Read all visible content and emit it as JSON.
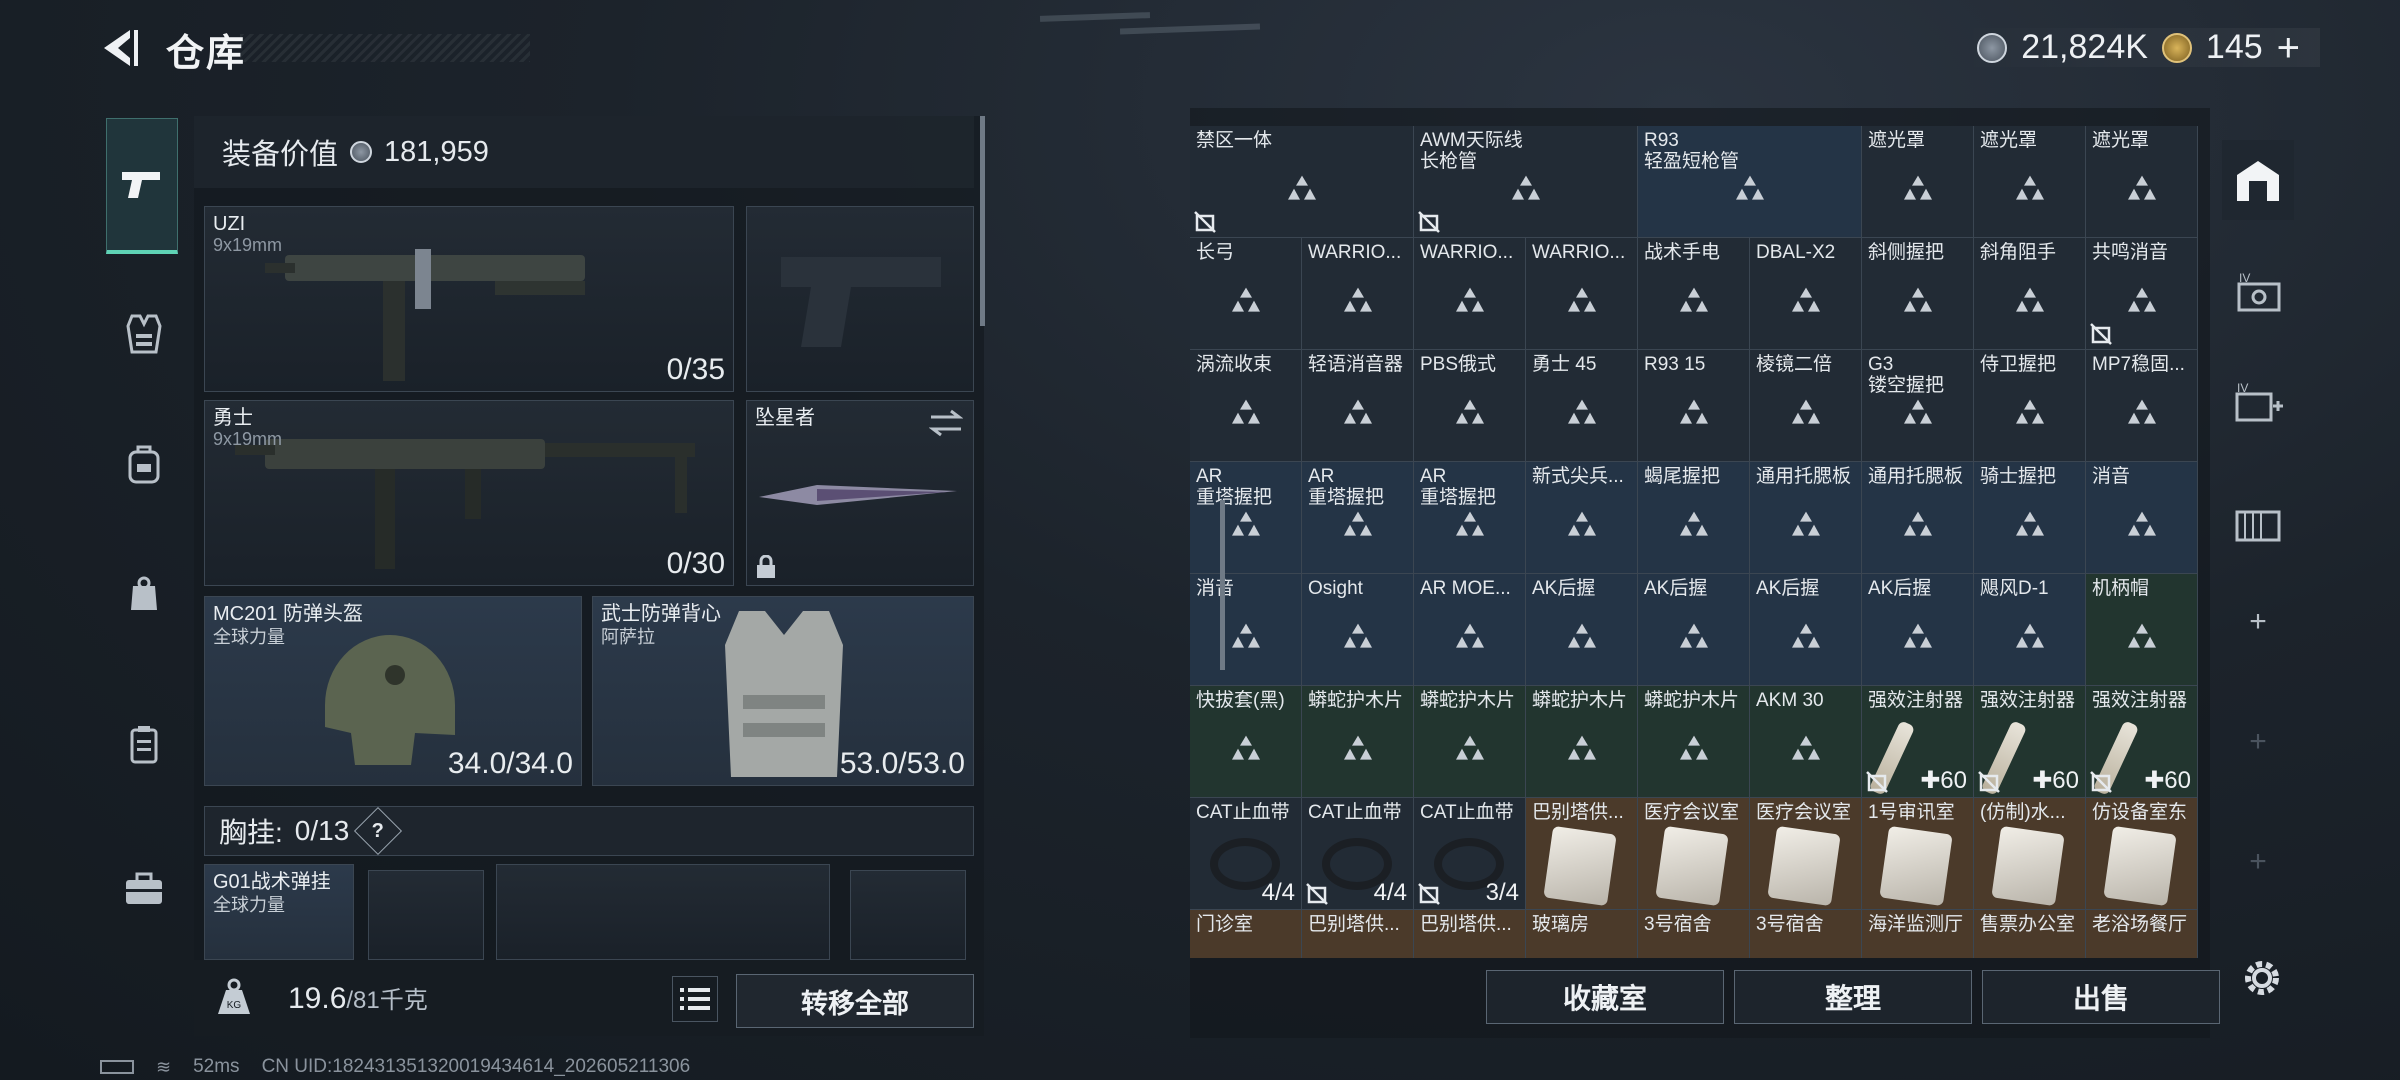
{
  "header": {
    "title": "仓库",
    "currency_silver": "21,824K",
    "currency_gold": "145"
  },
  "left_panel": {
    "equipment_value_label": "装备价值",
    "equipment_value": "181,959",
    "primary_weapon": {
      "name": "UZI",
      "ammo_type": "9x19mm",
      "ammo": "0/35"
    },
    "secondary_weapon": {
      "name": "勇士",
      "ammo_type": "9x19mm",
      "ammo": "0/30"
    },
    "melee": {
      "name": "坠星者"
    },
    "helmet": {
      "name": "MC201 防弹头盔",
      "faction": "全球力量",
      "durability": "34.0/34.0"
    },
    "vest": {
      "name": "武士防弹背心",
      "faction": "阿萨拉",
      "durability": "53.0/53.0"
    },
    "chest_rig": {
      "label": "胸挂:",
      "capacity": "0/13",
      "help": "?"
    },
    "rig_item": {
      "name": "G01战术弹挂",
      "faction": "全球力量"
    },
    "weight": {
      "current": "19.6",
      "max": "/81千克"
    },
    "transfer_all_label": "转移全部"
  },
  "right_panel": {
    "items": [
      {
        "label": "禁区一体",
        "sub": "",
        "row": 0,
        "col": 0,
        "w": 2,
        "style": "",
        "lock": true
      },
      {
        "label": "AWM天际线",
        "sub": "长枪管",
        "row": 0,
        "col": 2,
        "w": 2,
        "style": "",
        "lock": true
      },
      {
        "label": "R93",
        "sub": "轻盈短枪管",
        "row": 0,
        "col": 4,
        "w": 2,
        "style": "blue",
        "lock": false
      },
      {
        "label": "遮光罩",
        "sub": "",
        "row": 0,
        "col": 6,
        "w": 1,
        "style": "",
        "lock": false
      },
      {
        "label": "遮光罩",
        "sub": "",
        "row": 0,
        "col": 7,
        "w": 1,
        "style": "",
        "lock": false
      },
      {
        "label": "遮光罩",
        "sub": "",
        "row": 0,
        "col": 8,
        "w": 1,
        "style": "",
        "lock": false
      },
      {
        "label": "长弓",
        "sub": "",
        "row": 1,
        "col": 0,
        "w": 1,
        "style": "",
        "lock": false
      },
      {
        "label": "WARRIO...",
        "sub": "",
        "row": 1,
        "col": 1,
        "w": 1,
        "style": "",
        "lock": false
      },
      {
        "label": "WARRIO...",
        "sub": "",
        "row": 1,
        "col": 2,
        "w": 1,
        "style": "",
        "lock": false
      },
      {
        "label": "WARRIO...",
        "sub": "",
        "row": 1,
        "col": 3,
        "w": 1,
        "style": "",
        "lock": false
      },
      {
        "label": "战术手电",
        "sub": "",
        "row": 1,
        "col": 4,
        "w": 1,
        "style": "",
        "lock": false
      },
      {
        "label": "DBAL-X2",
        "sub": "",
        "row": 1,
        "col": 5,
        "w": 1,
        "style": "",
        "lock": false
      },
      {
        "label": "斜侧握把",
        "sub": "",
        "row": 1,
        "col": 6,
        "w": 1,
        "style": "",
        "lock": false
      },
      {
        "label": "斜角阻手",
        "sub": "",
        "row": 1,
        "col": 7,
        "w": 1,
        "style": "",
        "lock": false
      },
      {
        "label": "共鸣消音",
        "sub": "",
        "row": 1,
        "col": 8,
        "w": 1,
        "style": "",
        "lock": true
      },
      {
        "label": "涡流收束",
        "sub": "",
        "row": 2,
        "col": 0,
        "w": 1,
        "style": "",
        "lock": false
      },
      {
        "label": "轻语消音器",
        "sub": "",
        "row": 2,
        "col": 1,
        "w": 1,
        "style": "",
        "lock": false
      },
      {
        "label": "PBS俄式",
        "sub": "",
        "row": 2,
        "col": 2,
        "w": 1,
        "style": "",
        "lock": false
      },
      {
        "label": "勇士 45",
        "sub": "",
        "row": 2,
        "col": 3,
        "w": 1,
        "style": "",
        "lock": false
      },
      {
        "label": "R93 15",
        "sub": "",
        "row": 2,
        "col": 4,
        "w": 1,
        "style": "",
        "lock": false
      },
      {
        "label": "棱镜二倍",
        "sub": "",
        "row": 2,
        "col": 5,
        "w": 1,
        "style": "",
        "lock": false
      },
      {
        "label": "G3",
        "sub": "镂空握把",
        "row": 2,
        "col": 6,
        "w": 1,
        "style": "",
        "lock": false
      },
      {
        "label": "侍卫握把",
        "sub": "",
        "row": 2,
        "col": 7,
        "w": 1,
        "style": "",
        "lock": false
      },
      {
        "label": "MP7稳固...",
        "sub": "",
        "row": 2,
        "col": 8,
        "w": 1,
        "style": "",
        "lock": false
      },
      {
        "label": "AR",
        "sub": "重塔握把",
        "row": 3,
        "col": 0,
        "w": 1,
        "style": "blue",
        "lock": false
      },
      {
        "label": "AR",
        "sub": "重塔握把",
        "row": 3,
        "col": 1,
        "w": 1,
        "style": "blue",
        "lock": false
      },
      {
        "label": "AR",
        "sub": "重塔握把",
        "row": 3,
        "col": 2,
        "w": 1,
        "style": "blue",
        "lock": false
      },
      {
        "label": "新式尖兵...",
        "sub": "",
        "row": 3,
        "col": 3,
        "w": 1,
        "style": "blue",
        "lock": false
      },
      {
        "label": "蝎尾握把",
        "sub": "",
        "row": 3,
        "col": 4,
        "w": 1,
        "style": "blue",
        "lock": false
      },
      {
        "label": "通用托腮板",
        "sub": "",
        "row": 3,
        "col": 5,
        "w": 1,
        "style": "blue",
        "lock": false
      },
      {
        "label": "通用托腮板",
        "sub": "",
        "row": 3,
        "col": 6,
        "w": 1,
        "style": "blue",
        "lock": false
      },
      {
        "label": "骑士握把",
        "sub": "",
        "row": 3,
        "col": 7,
        "w": 1,
        "style": "blue",
        "lock": false
      },
      {
        "label": "消音",
        "sub": "",
        "row": 3,
        "col": 8,
        "w": 1,
        "style": "blue",
        "lock": false
      },
      {
        "label": "消音",
        "sub": "",
        "row": 4,
        "col": 0,
        "w": 1,
        "style": "blue",
        "lock": false
      },
      {
        "label": "Osight",
        "sub": "",
        "row": 4,
        "col": 1,
        "w": 1,
        "style": "blue",
        "lock": false
      },
      {
        "label": "AR MOE...",
        "sub": "",
        "row": 4,
        "col": 2,
        "w": 1,
        "style": "blue",
        "lock": false
      },
      {
        "label": "AK后握",
        "sub": "",
        "row": 4,
        "col": 3,
        "w": 1,
        "style": "blue",
        "lock": false
      },
      {
        "label": "AK后握",
        "sub": "",
        "row": 4,
        "col": 4,
        "w": 1,
        "style": "blue",
        "lock": false
      },
      {
        "label": "AK后握",
        "sub": "",
        "row": 4,
        "col": 5,
        "w": 1,
        "style": "blue",
        "lock": false
      },
      {
        "label": "AK后握",
        "sub": "",
        "row": 4,
        "col": 6,
        "w": 1,
        "style": "blue",
        "lock": false
      },
      {
        "label": "飓风D-1",
        "sub": "",
        "row": 4,
        "col": 7,
        "w": 1,
        "style": "blue",
        "lock": false
      },
      {
        "label": "机柄帽",
        "sub": "",
        "row": 4,
        "col": 8,
        "w": 1,
        "style": "green",
        "lock": false
      },
      {
        "label": "快拔套(黑)",
        "sub": "",
        "row": 5,
        "col": 0,
        "w": 1,
        "style": "green",
        "lock": false
      },
      {
        "label": "蟒蛇护木片",
        "sub": "",
        "row": 5,
        "col": 1,
        "w": 1,
        "style": "green",
        "lock": false
      },
      {
        "label": "蟒蛇护木片",
        "sub": "",
        "row": 5,
        "col": 2,
        "w": 1,
        "style": "green",
        "lock": false
      },
      {
        "label": "蟒蛇护木片",
        "sub": "",
        "row": 5,
        "col": 3,
        "w": 1,
        "style": "green",
        "lock": false
      },
      {
        "label": "蟒蛇护木片",
        "sub": "",
        "row": 5,
        "col": 4,
        "w": 1,
        "style": "green",
        "lock": false
      },
      {
        "label": "AKM 30",
        "sub": "",
        "row": 5,
        "col": 5,
        "w": 1,
        "style": "green",
        "lock": false
      },
      {
        "label": "强效注射器",
        "sub": "",
        "row": 5,
        "col": 6,
        "w": 1,
        "style": "green",
        "lock": true,
        "qty": "✚60",
        "img": "syringe"
      },
      {
        "label": "强效注射器",
        "sub": "",
        "row": 5,
        "col": 7,
        "w": 1,
        "style": "green",
        "lock": true,
        "qty": "✚60",
        "img": "syringe"
      },
      {
        "label": "强效注射器",
        "sub": "",
        "row": 5,
        "col": 8,
        "w": 1,
        "style": "green",
        "lock": true,
        "qty": "✚60",
        "img": "syringe"
      },
      {
        "label": "CAT止血带",
        "sub": "",
        "row": 6,
        "col": 0,
        "w": 1,
        "style": "",
        "lock": false,
        "qty": "4/4",
        "img": "tourn"
      },
      {
        "label": "CAT止血带",
        "sub": "",
        "row": 6,
        "col": 1,
        "w": 1,
        "style": "",
        "lock": true,
        "qty": "4/4",
        "img": "tourn"
      },
      {
        "label": "CAT止血带",
        "sub": "",
        "row": 6,
        "col": 2,
        "w": 1,
        "style": "",
        "lock": true,
        "qty": "3/4",
        "img": "tourn"
      },
      {
        "label": "巴别塔供...",
        "sub": "",
        "row": 6,
        "col": 3,
        "w": 1,
        "style": "orange",
        "lock": false,
        "img": "card"
      },
      {
        "label": "医疗会议室",
        "sub": "",
        "row": 6,
        "col": 4,
        "w": 1,
        "style": "orange",
        "lock": false,
        "img": "card"
      },
      {
        "label": "医疗会议室",
        "sub": "",
        "row": 6,
        "col": 5,
        "w": 1,
        "style": "orange",
        "lock": false,
        "img": "card"
      },
      {
        "label": "1号审讯室",
        "sub": "",
        "row": 6,
        "col": 6,
        "w": 1,
        "style": "orange",
        "lock": false,
        "img": "card"
      },
      {
        "label": "(仿制)水...",
        "sub": "",
        "row": 6,
        "col": 7,
        "w": 1,
        "style": "orange",
        "lock": false,
        "img": "card"
      },
      {
        "label": "仿设备室东",
        "sub": "",
        "row": 6,
        "col": 8,
        "w": 1,
        "style": "orange",
        "lock": false,
        "img": "card"
      },
      {
        "label": "门诊室",
        "sub": "",
        "row": 7,
        "col": 0,
        "w": 1,
        "style": "orange",
        "lock": false
      },
      {
        "label": "巴别塔供...",
        "sub": "",
        "row": 7,
        "col": 1,
        "w": 1,
        "style": "orange",
        "lock": false
      },
      {
        "label": "巴别塔供...",
        "sub": "",
        "row": 7,
        "col": 2,
        "w": 1,
        "style": "orange",
        "lock": false
      },
      {
        "label": "玻璃房",
        "sub": "",
        "row": 7,
        "col": 3,
        "w": 1,
        "style": "orange",
        "lock": false
      },
      {
        "label": "3号宿舍",
        "sub": "",
        "row": 7,
        "col": 4,
        "w": 1,
        "style": "orange",
        "lock": false
      },
      {
        "label": "3号宿舍",
        "sub": "",
        "row": 7,
        "col": 5,
        "w": 1,
        "style": "orange",
        "lock": false
      },
      {
        "label": "海洋监测厅",
        "sub": "",
        "row": 7,
        "col": 6,
        "w": 1,
        "style": "orange",
        "lock": false
      },
      {
        "label": "售票办公室",
        "sub": "",
        "row": 7,
        "col": 7,
        "w": 1,
        "style": "orange",
        "lock": false
      },
      {
        "label": "老浴场餐厅",
        "sub": "",
        "row": 7,
        "col": 8,
        "w": 1,
        "style": "orange",
        "lock": false
      }
    ],
    "actions": {
      "collection": "收藏室",
      "sort": "整理",
      "sell": "出售"
    }
  },
  "right_rail": {
    "add": "+"
  },
  "status": {
    "ping": "52ms",
    "uid": "CN UID:18243135132001943461​4_202605211306"
  },
  "colors": {
    "accent": "#5fd3b5",
    "blue_slot": "#243446",
    "green_slot": "#22352f",
    "orange_slot": "#4b3a2a"
  }
}
